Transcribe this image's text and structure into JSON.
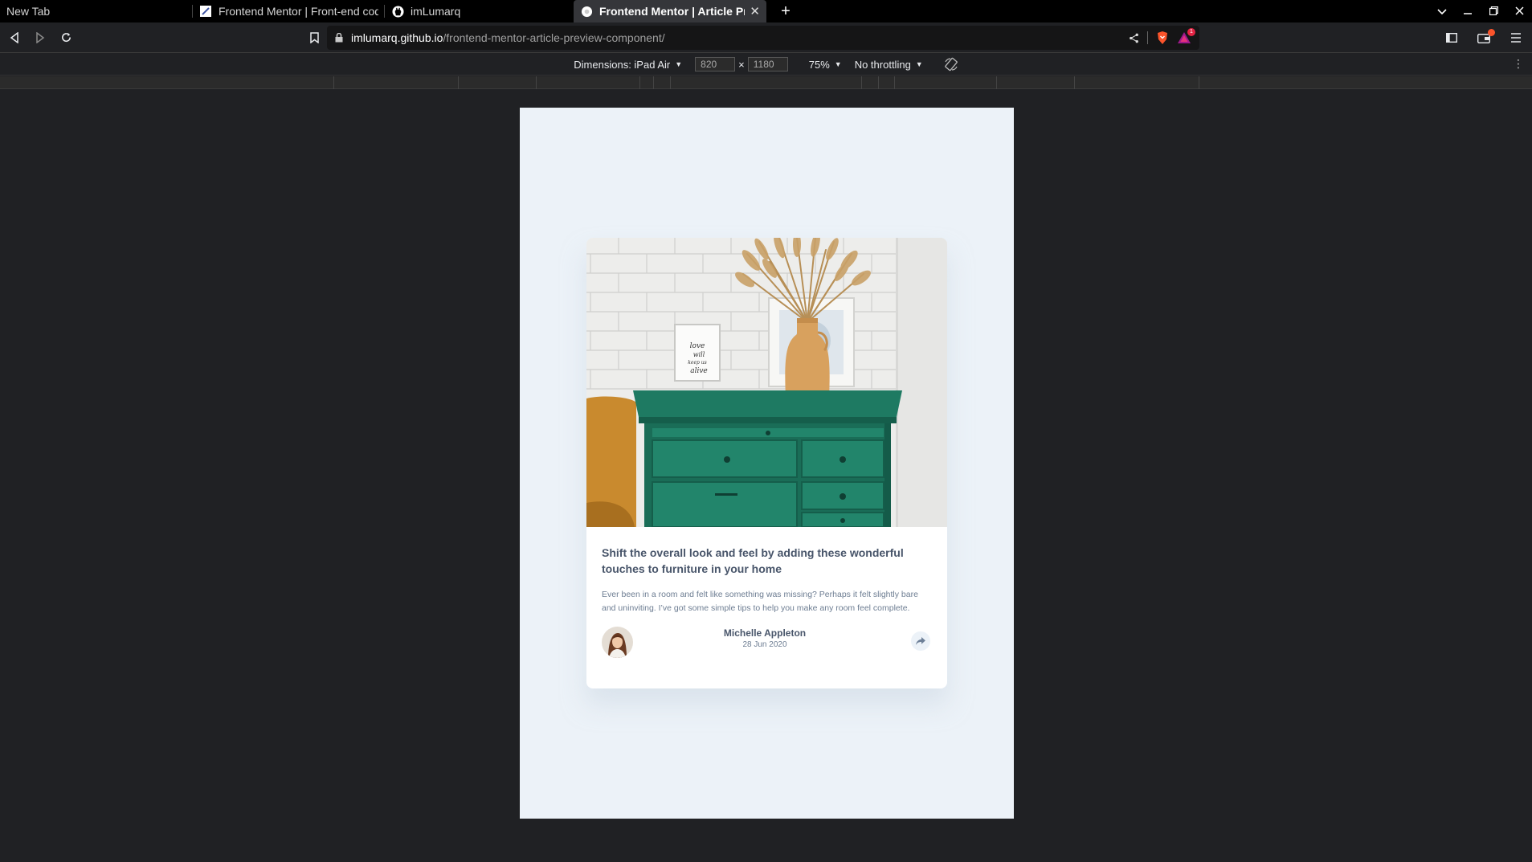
{
  "browser": {
    "tabs": [
      {
        "label": "New Tab",
        "active": false
      },
      {
        "label": "Frontend Mentor | Front-end codi",
        "active": false
      },
      {
        "label": "imLumarq",
        "active": false
      },
      {
        "label": "Frontend Mentor | Article Previ",
        "active": true
      }
    ],
    "address": {
      "host": "imlumarq.github.io",
      "path": "/frontend-mentor-article-preview-component/"
    },
    "shields_badge": "1"
  },
  "device_toolbar": {
    "dimensions_label": "Dimensions: iPad Air",
    "width_value": "820",
    "times": "×",
    "height_value": "1180",
    "zoom": "75%",
    "throttling": "No throttling"
  },
  "card": {
    "title": "Shift the overall look and feel by adding these wonderful touches to furniture in your home",
    "description": "Ever been in a room and felt like something was missing? Perhaps it felt slightly bare and uninviting. I’ve got some simple tips to help you make any room feel complete.",
    "author_name": "Michelle Appleton",
    "date": "28 Jun 2020",
    "hero_frame_text": "love will keep us alive"
  },
  "colors": {
    "page_bg": "#ecf2f8",
    "heading": "#48556a",
    "body_text": "#6d7d92",
    "cabinet_green": "#1e7a62",
    "accent_brave": "#fb542b"
  }
}
